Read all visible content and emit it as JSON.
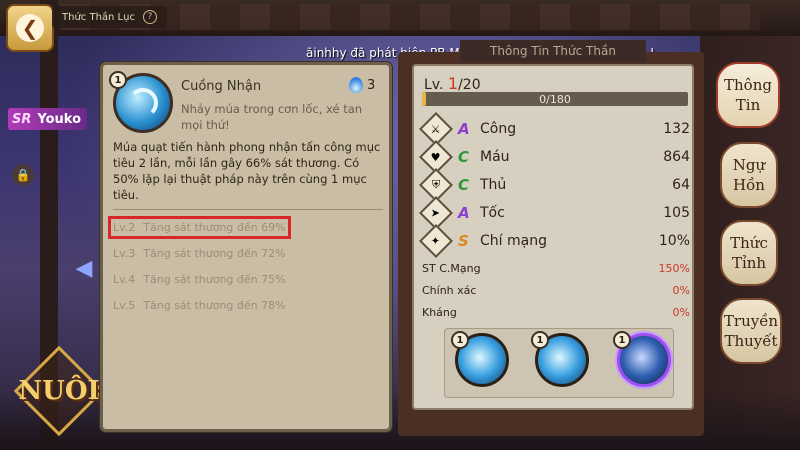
{
  "header": {
    "title": "Thức Thần Lục",
    "back_icon": "back-arrow-icon"
  },
  "marquee": "ãinhhy  đã phát hiện PB Mảnh Khế Ước Chouchin Obake , I",
  "character": {
    "rarity": "SR",
    "name": "Youko"
  },
  "logo_text": "NUÔI",
  "skill_popup": {
    "level": "1",
    "name": "Cuồng Nhận",
    "cost": "3",
    "subtitle": "Nhảy múa trong cơn lốc, xé tan mọi thứ!",
    "description": "Múa quạt tiến hành phong nhận tấn công mục tiêu 2 lần, mỗi lần gây 66% sát thương. Có 50% lặp lại thuật pháp này trên cùng 1 mục tiêu.",
    "upgrades": [
      {
        "lv": "Lv.2",
        "text": "Tăng sát thương đến 69%"
      },
      {
        "lv": "Lv.3",
        "text": "Tăng sát thương đến 72%"
      },
      {
        "lv": "Lv.4",
        "text": "Tăng sát thương đến 75%"
      },
      {
        "lv": "Lv.5",
        "text": "Tăng sát thương đến 78%"
      }
    ]
  },
  "stats": {
    "panel_title": "Thông Tin Thức Thần",
    "level_prefix": "Lv.",
    "level_current": "1",
    "level_max": "/20",
    "exp_text": "0/180",
    "exp_fraction": 0.0,
    "main": [
      {
        "icon": "attack-icon",
        "grade": "A",
        "grade_color": "#8a3fd0",
        "name": "Công",
        "value": "132"
      },
      {
        "icon": "hp-icon",
        "grade": "C",
        "grade_color": "#2a9a3a",
        "name": "Máu",
        "value": "864"
      },
      {
        "icon": "defense-icon",
        "grade": "C",
        "grade_color": "#2a9a3a",
        "name": "Thủ",
        "value": "64"
      },
      {
        "icon": "speed-icon",
        "grade": "A",
        "grade_color": "#8a3fd0",
        "name": "Tốc",
        "value": "105"
      },
      {
        "icon": "crit-icon",
        "grade": "S",
        "grade_color": "#d98a1e",
        "name": "Chí mạng",
        "value": "10%"
      }
    ],
    "secondary": [
      {
        "name": "ST C.Mạng",
        "value": "150%"
      },
      {
        "name": "Chính xác",
        "value": "0%"
      },
      {
        "name": "Kháng",
        "value": "0%"
      }
    ],
    "skill_levels": [
      "1",
      "1",
      "1"
    ]
  },
  "tabs": [
    {
      "label": "Thông Tin"
    },
    {
      "label": "Ngự Hồn"
    },
    {
      "label": "Thức Tỉnh"
    },
    {
      "label": "Truyền Thuyết"
    }
  ]
}
